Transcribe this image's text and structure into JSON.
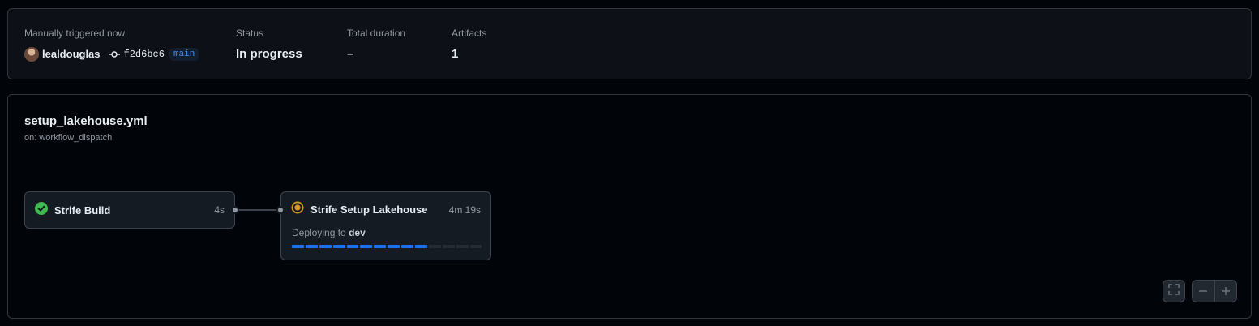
{
  "summary": {
    "trigger_label": "Manually triggered now",
    "actor": "lealdouglas",
    "commit_sha": "f2d6bc6",
    "branch": "main",
    "status_label": "Status",
    "status_value": "In progress",
    "duration_label": "Total duration",
    "duration_value": "–",
    "artifacts_label": "Artifacts",
    "artifacts_value": "1"
  },
  "workflow": {
    "file": "setup_lakehouse.yml",
    "trigger": "on: workflow_dispatch"
  },
  "jobs": [
    {
      "name": "Strife Build",
      "duration": "4s",
      "status": "success",
      "icon": "check-circle-icon"
    },
    {
      "name": "Strife Setup Lakehouse",
      "duration": "4m 19s",
      "status": "in_progress",
      "icon": "in-progress-icon",
      "deploy_prefix": "Deploying to",
      "environment": "dev",
      "progress_filled": 10,
      "progress_total": 14
    }
  ],
  "colors": {
    "success": "#3fb950",
    "in_progress": "#d29922",
    "progress": "#1f6feb",
    "branch": "#4493f8"
  }
}
